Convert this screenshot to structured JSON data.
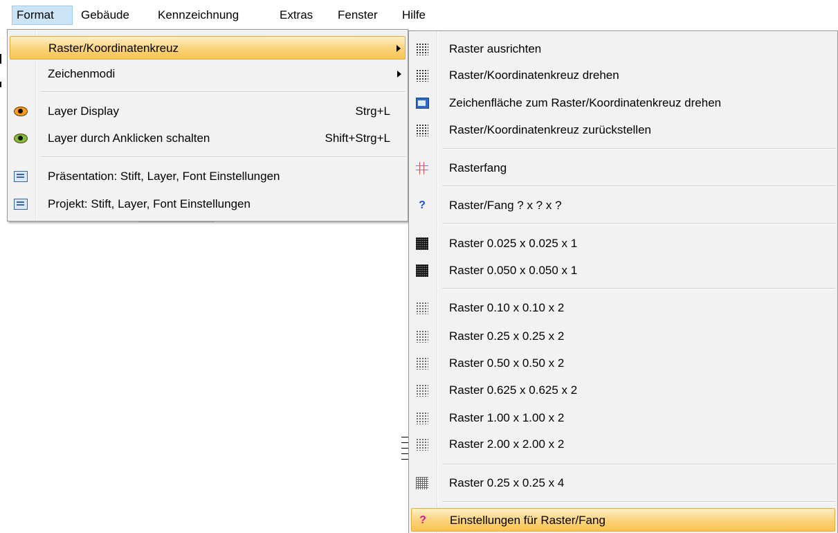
{
  "menubar": {
    "items": [
      {
        "label": "Format",
        "active": true
      },
      {
        "label": "Gebäude"
      },
      {
        "label": "Kennzeichnung"
      },
      {
        "label": "Extras"
      },
      {
        "label": "Fenster"
      },
      {
        "label": "Hilfe"
      }
    ]
  },
  "format_menu": {
    "items": [
      {
        "label": "Raster/Koordinatenkreuz",
        "submenu": true,
        "highlighted": true
      },
      {
        "label": "Zeichenmodi",
        "submenu": true
      },
      {
        "label": "Layer Display",
        "shortcut": "Strg+L",
        "icon": "eye-icon"
      },
      {
        "label": "Layer durch Anklicken schalten",
        "shortcut": "Shift+Strg+L",
        "icon": "eye-toggle-icon"
      },
      {
        "label": "Präsentation: Stift, Layer, Font Einstellungen",
        "icon": "presentation-settings-icon"
      },
      {
        "label": "Projekt: Stift, Layer, Font Einstellungen",
        "icon": "project-settings-icon"
      }
    ]
  },
  "raster_submenu": {
    "items": [
      {
        "label": "Raster ausrichten",
        "icon": "grid-align-icon"
      },
      {
        "label": "Raster/Koordinatenkreuz drehen",
        "icon": "grid-rotate-icon"
      },
      {
        "label": "Zeichenfläche zum Raster/Koordinatenkreuz drehen",
        "icon": "canvas-rotate-icon"
      },
      {
        "label": "Raster/Koordinatenkreuz zurückstellen",
        "icon": "grid-reset-icon"
      },
      {
        "label": "Rasterfang",
        "icon": "grid-snap-icon"
      },
      {
        "label": "Raster/Fang ? x ? x ?",
        "icon": "grid-question-icon"
      },
      {
        "label": "Raster 0.025 x 0.025 x 1",
        "icon": "dense-grid-icon"
      },
      {
        "label": "Raster 0.050 x 0.050 x 1",
        "icon": "dense-grid-icon"
      },
      {
        "label": "Raster 0.10 x 0.10 x 2",
        "icon": "dot-grid-icon"
      },
      {
        "label": "Raster 0.25 x 0.25 x 2",
        "icon": "dot-grid-icon"
      },
      {
        "label": "Raster 0.50 x 0.50 x 2",
        "icon": "dot-grid-icon"
      },
      {
        "label": "Raster 0.625 x 0.625 x 2",
        "icon": "dot-grid-icon"
      },
      {
        "label": "Raster 1.00 x 1.00 x 2",
        "icon": "dot-grid-icon"
      },
      {
        "label": "Raster 2.00 x 2.00 x 2",
        "icon": "dot-grid-icon"
      },
      {
        "label": "Raster 0.25 x 0.25 x 4",
        "icon": "mesh-grid-icon"
      },
      {
        "label": "Einstellungen für Raster/Fang",
        "icon": "grid-settings-question-icon",
        "highlighted": true
      }
    ]
  }
}
